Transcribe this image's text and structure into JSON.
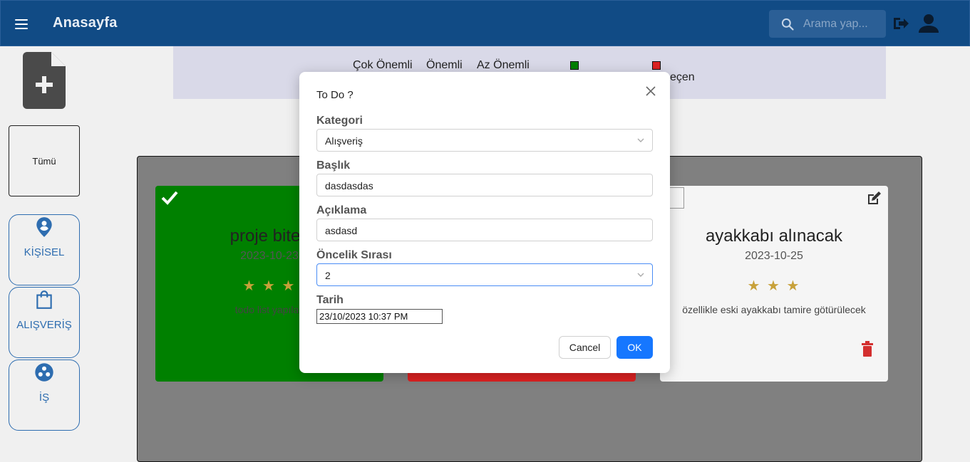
{
  "appbar": {
    "title": "Anasayfa",
    "search_placeholder": "Arama yap..."
  },
  "legend": {
    "items": [
      "Çok Önemli",
      "Önemli",
      "Az Önemli"
    ],
    "passed_label": "eçen",
    "colors": {
      "done": "#008000",
      "passed": "#dd2222"
    }
  },
  "sidebar": {
    "all_label": "Tümü",
    "categories": [
      {
        "label": "KİŞİSEL",
        "icon": "person-pin-icon"
      },
      {
        "label": "ALIŞVERİŞ",
        "icon": "shopping-bag-icon"
      },
      {
        "label": "İŞ",
        "icon": "workspaces-icon"
      }
    ]
  },
  "cards": [
    {
      "title": "proje bitec",
      "date": "2023-10-23",
      "stars": "★ ★ ★",
      "description": "todo list yapılac"
    },
    {
      "title": "",
      "date": "",
      "stars": "",
      "description": ""
    },
    {
      "title": "ayakkabı alınacak",
      "date": "2023-10-25",
      "stars": "★ ★ ★",
      "description": "özellikle eski ayakkabı tamire götürülecek"
    }
  ],
  "modal": {
    "title": "To Do ?",
    "category_label": "Kategori",
    "category_value": "Alışveriş",
    "heading_label": "Başlık",
    "heading_value": "dasdasdas",
    "description_label": "Açıklama",
    "description_value": "asdasd",
    "priority_label": "Öncelik Sırası",
    "priority_value": "2",
    "date_label": "Tarih",
    "date_value": "23/10/2023 10:37 PM",
    "cancel_label": "Cancel",
    "ok_label": "OK"
  },
  "colors": {
    "appbar": "#114b85",
    "accent": "#1677ff",
    "category_border": "#2e6db0"
  }
}
